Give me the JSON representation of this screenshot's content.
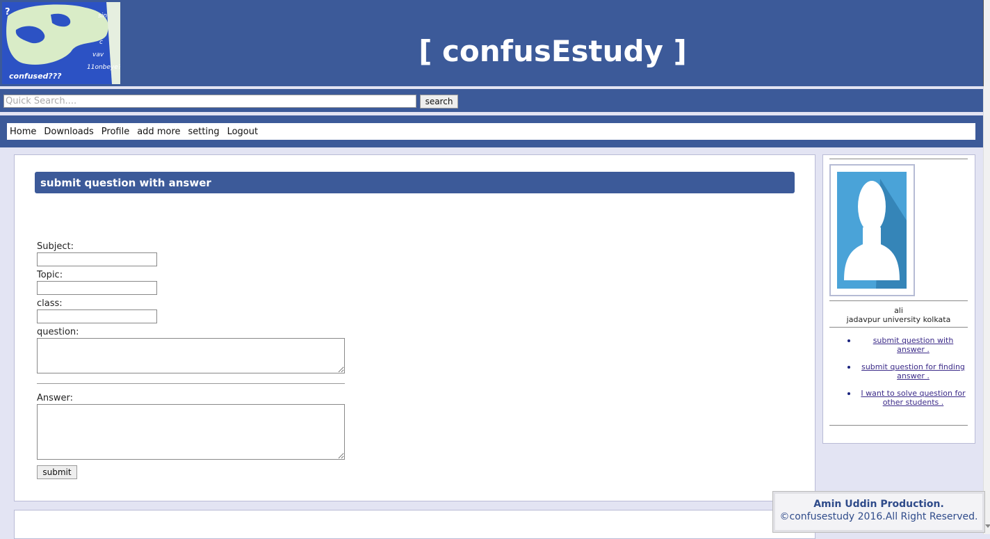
{
  "header": {
    "title": "[ confusEstudy ]",
    "logo_text": "confused???"
  },
  "search": {
    "placeholder": "Quick Search....",
    "button_label": "search"
  },
  "nav": {
    "items": [
      "Home",
      "Downloads",
      "Profile",
      "add more",
      "setting",
      "Logout"
    ]
  },
  "main": {
    "panel_title": "submit question with answer",
    "form": {
      "subject_label": "Subject:",
      "topic_label": "Topic:",
      "class_label": "class:",
      "question_label": "question:",
      "answer_label": "Answer:",
      "submit_label": "submit"
    }
  },
  "sidebar": {
    "user_name": "ali",
    "user_university": "jadavpur university kolkata",
    "links": [
      "submit question with answer .",
      "submit question for finding answer .",
      "I want to solve question for other students ."
    ]
  },
  "footer": {
    "credit": "Amin Uddin Production.",
    "copyright": "©confusestudy 2016.All Right Reserved."
  },
  "colors": {
    "brand_blue": "#3c5a99",
    "page_background": "#e3e4f3",
    "link_color": "#3b2a88"
  }
}
